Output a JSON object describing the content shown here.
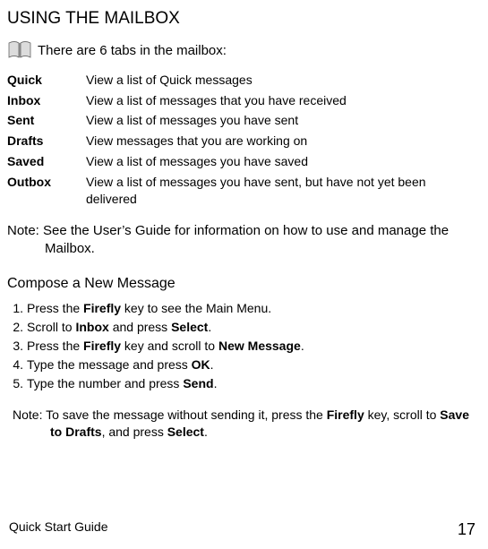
{
  "title": "USING THE MAILBOX",
  "intro": "There are 6 tabs in the mailbox:",
  "tabs": [
    {
      "label": "Quick",
      "desc": "View a list of Quick messages"
    },
    {
      "label": "Inbox",
      "desc": "View a list of messages that you have received"
    },
    {
      "label": "Sent",
      "desc": "View a list of messages you have sent"
    },
    {
      "label": "Drafts",
      "desc": "View messages that you are working on"
    },
    {
      "label": "Saved",
      "desc": "View a list of messages you have saved"
    },
    {
      "label": "Outbox",
      "desc": "View a list of messages you have sent, but have not yet been delivered"
    }
  ],
  "note1": "Note: See the User’s Guide for information on how to use and manage the Mailbox.",
  "subtitle": "Compose a New Message",
  "steps": [
    {
      "n": "1.",
      "pre": "Press the ",
      "b1": "Firefly",
      "post": " key to see the Main Menu."
    },
    {
      "n": "2.",
      "pre": "Scroll to ",
      "b1": "Inbox",
      "mid": " and press ",
      "b2": "Select",
      "post": "."
    },
    {
      "n": "3.",
      "pre": "Press the ",
      "b1": "Firefly",
      "mid": " key and scroll to ",
      "b2": "New Message",
      "post": "."
    },
    {
      "n": "4.",
      "pre": "Type the message and press ",
      "b1": "OK",
      "post": "."
    },
    {
      "n": "5.",
      "pre": "Type the number and press ",
      "b1": "Send",
      "post": "."
    }
  ],
  "note2": {
    "pre": "Note: To save the message without sending it, press the ",
    "b1": "Firefly",
    "mid1": " key, scroll to ",
    "b2": "Save to Drafts",
    "mid2": ", and press ",
    "b3": "Select",
    "post": "."
  },
  "footer_left": "Quick Start Guide",
  "footer_right": "17"
}
